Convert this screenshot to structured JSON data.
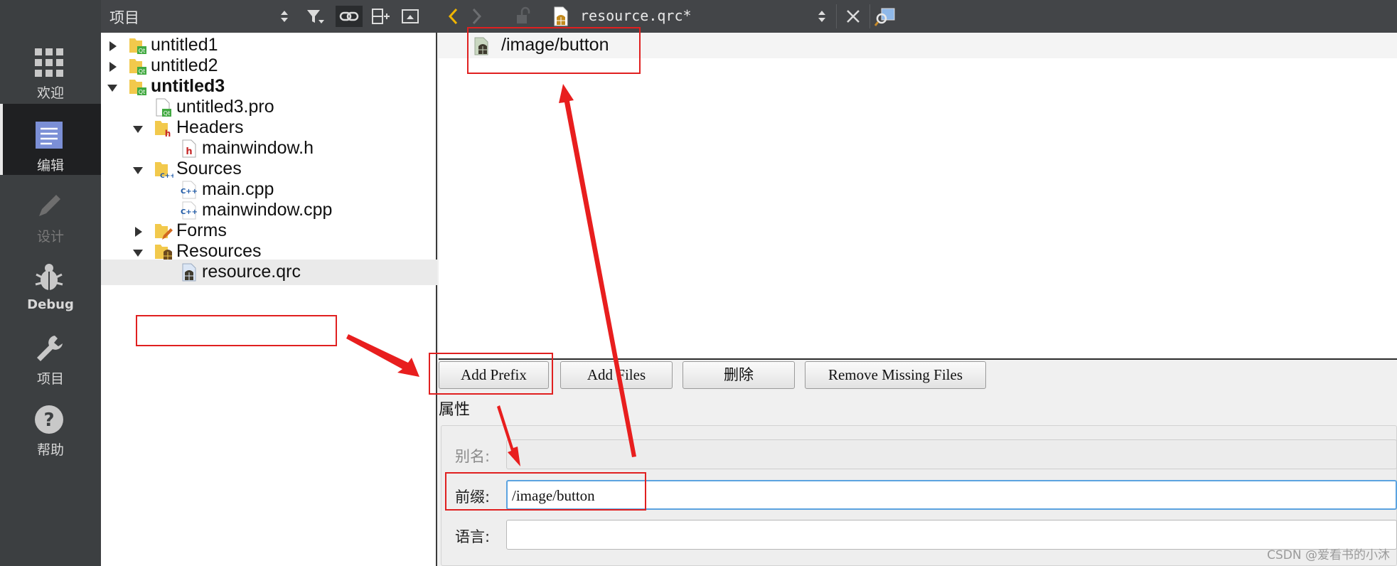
{
  "modebar": {
    "items": [
      {
        "label": "欢迎",
        "icon": "grid-icon"
      },
      {
        "label": "编辑",
        "icon": "document-icon"
      },
      {
        "label": "设计",
        "icon": "pencil-icon"
      },
      {
        "label": "Debug",
        "icon": "bug-icon"
      },
      {
        "label": "项目",
        "icon": "wrench-icon"
      },
      {
        "label": "帮助",
        "icon": "question-icon"
      }
    ]
  },
  "project_panel": {
    "title": "项目",
    "tree": [
      {
        "label": "untitled1",
        "icon": "qt-project-folder-icon",
        "expanded": false
      },
      {
        "label": "untitled2",
        "icon": "qt-project-folder-icon",
        "expanded": false
      },
      {
        "label": "untitled3",
        "icon": "qt-project-folder-icon",
        "expanded": true
      },
      {
        "label": "untitled3.pro",
        "icon": "qt-pro-file-icon"
      },
      {
        "label": "Headers",
        "icon": "headers-folder-icon",
        "expanded": true
      },
      {
        "label": "mainwindow.h",
        "icon": "header-file-icon"
      },
      {
        "label": "Sources",
        "icon": "sources-folder-icon",
        "expanded": true
      },
      {
        "label": "main.cpp",
        "icon": "cpp-file-icon"
      },
      {
        "label": "mainwindow.cpp",
        "icon": "cpp-file-icon"
      },
      {
        "label": "Forms",
        "icon": "forms-folder-icon",
        "expanded": false
      },
      {
        "label": "Resources",
        "icon": "resources-folder-icon",
        "expanded": true
      },
      {
        "label": "resource.qrc",
        "icon": "qrc-file-icon",
        "selected": true
      }
    ]
  },
  "editor": {
    "file_name": "resource.qrc*",
    "prefix_item": "/image/button"
  },
  "buttons": {
    "add_prefix": "Add Prefix",
    "add_files": "Add Files",
    "delete": "删除",
    "remove_missing": "Remove Missing Files"
  },
  "properties": {
    "title": "属性",
    "alias_label": "别名:",
    "alias_value": "",
    "prefix_label": "前缀:",
    "prefix_value": "/image/button",
    "language_label": "语言:",
    "language_value": ""
  },
  "watermark": "CSDN @爱看书的小沐",
  "colors": {
    "annotation": "#e02020",
    "sidebar": "#3c3f41",
    "toolbar": "#434548"
  }
}
